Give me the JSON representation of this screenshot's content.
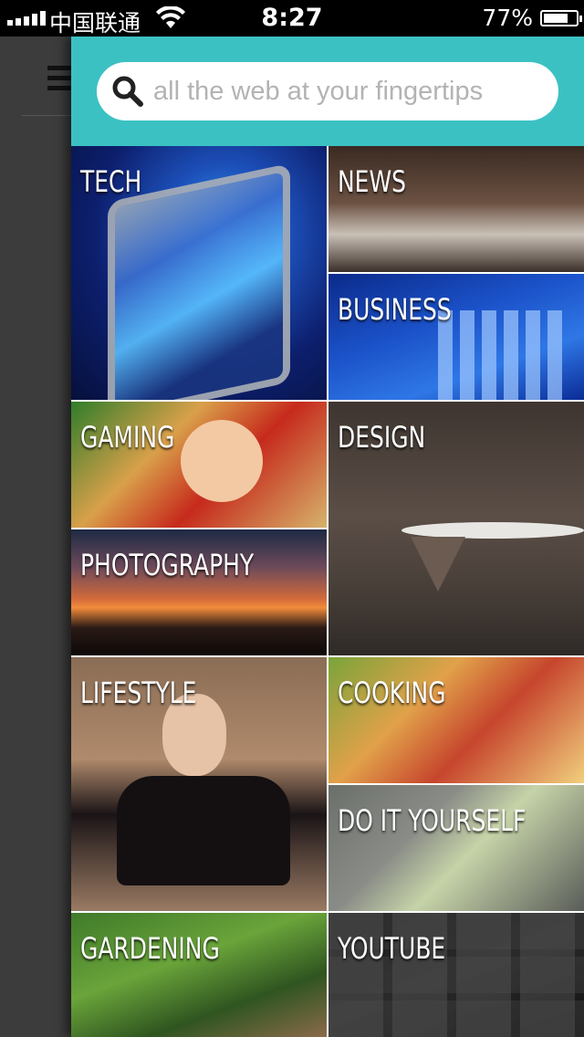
{
  "status_bar": {
    "carrier": "中国联通",
    "time": "8:27",
    "battery": "77%",
    "battery_level": 0.77,
    "signal_bars": 5
  },
  "search": {
    "placeholder": "all the web at your fingertips"
  },
  "categories": [
    {
      "id": "tech",
      "label": "TECH"
    },
    {
      "id": "news",
      "label": "NEWS"
    },
    {
      "id": "business",
      "label": "BUSINESS"
    },
    {
      "id": "gaming",
      "label": "GAMING"
    },
    {
      "id": "design",
      "label": "DESIGN"
    },
    {
      "id": "photography",
      "label": "PHOTOGRAPHY"
    },
    {
      "id": "lifestyle",
      "label": "LIFESTYLE"
    },
    {
      "id": "cooking",
      "label": "COOKING"
    },
    {
      "id": "diy",
      "label": "DO IT YOURSELF"
    },
    {
      "id": "gardening",
      "label": "GARDENING"
    },
    {
      "id": "youtube",
      "label": "YOUTUBE"
    }
  ],
  "colors": {
    "header": "#3cc1c3",
    "status_bar": "#000000",
    "background_app": "#3c3c3c"
  },
  "icons": [
    "search-icon",
    "wifi-icon",
    "battery-icon",
    "signal-icon",
    "menu-icon"
  ]
}
